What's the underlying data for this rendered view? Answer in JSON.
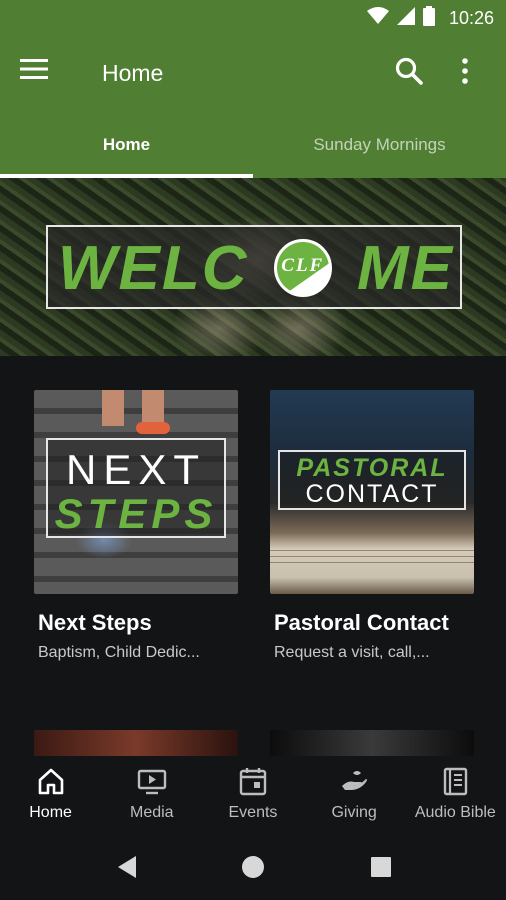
{
  "status_bar": {
    "time": "10:26",
    "icons": [
      "wifi-icon",
      "cell-signal-icon",
      "battery-icon"
    ]
  },
  "app_bar": {
    "title": "Home",
    "menu_icon": "hamburger-menu-icon",
    "search_icon": "search-icon",
    "more_icon": "more-vert-icon"
  },
  "tabs": [
    {
      "label": "Home",
      "active": true
    },
    {
      "label": "Sunday Mornings",
      "active": false
    }
  ],
  "banner": {
    "word_left": "WELC",
    "word_right": "ME",
    "logo_letters": "CLF"
  },
  "cards": [
    {
      "title": "Next Steps",
      "subtitle": "Baptism, Child Dedic...",
      "image_line1": "NEXT",
      "image_line2": "STEPS"
    },
    {
      "title": "Pastoral Contact",
      "subtitle": "Request a visit, call,...",
      "image_line1": "PASTORAL",
      "image_line2": "CONTACT"
    }
  ],
  "bottom_nav": [
    {
      "label": "Home",
      "icon": "home-icon",
      "active": true
    },
    {
      "label": "Media",
      "icon": "media-icon",
      "active": false
    },
    {
      "label": "Events",
      "icon": "calendar-icon",
      "active": false
    },
    {
      "label": "Giving",
      "icon": "giving-hand-icon",
      "active": false
    },
    {
      "label": "Audio Bible",
      "icon": "bible-icon",
      "active": false
    }
  ],
  "system_nav": [
    "back-icon",
    "home-circle-icon",
    "recents-icon"
  ],
  "colors": {
    "primary": "#507f33",
    "accent_green": "#6cb341",
    "background": "#131416"
  }
}
